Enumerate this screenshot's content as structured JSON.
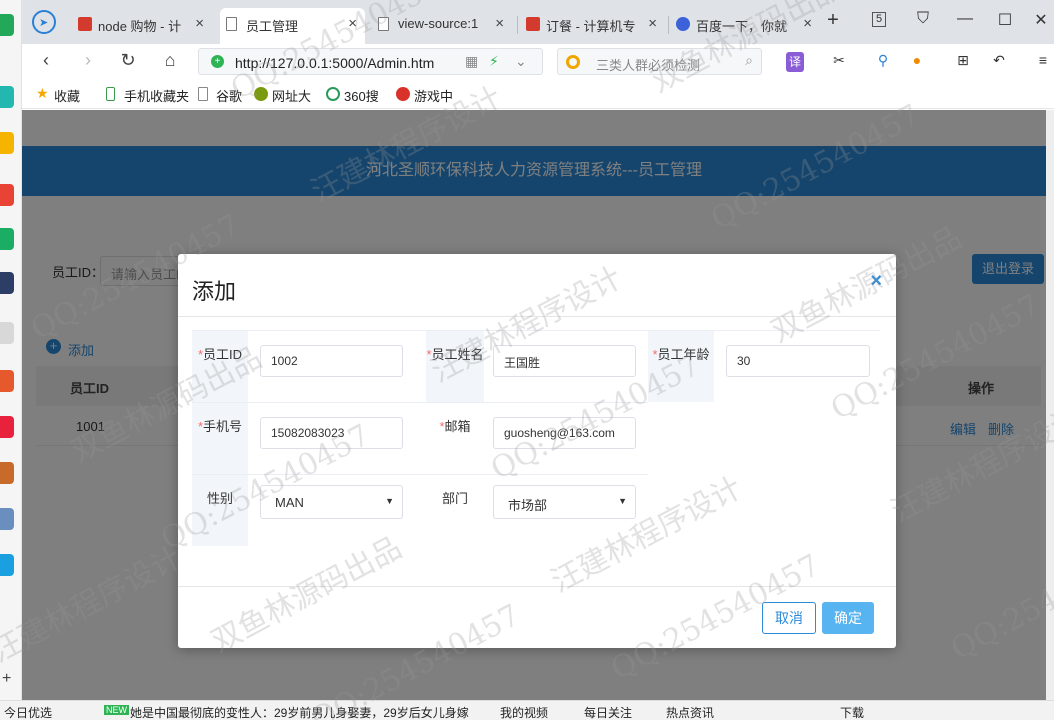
{
  "browser": {
    "tabs": [
      {
        "title": "node 购物 - 计",
        "close": "×"
      },
      {
        "title": "员工管理",
        "close": "×"
      },
      {
        "title": "view-source:1",
        "close": "×"
      },
      {
        "title": "订餐 - 计算机专",
        "close": "×"
      },
      {
        "title": "百度一下，你就",
        "close": "×"
      }
    ],
    "new_tab": "+",
    "badge": "5",
    "url": "http://127.0.0.1:5000/Admin.htm",
    "search_placeholder": "三类人群必须检测",
    "translate": "译",
    "bookmarks": [
      "收藏",
      "手机收藏夹",
      "谷歌",
      "网址大",
      "360搜",
      "游戏中"
    ]
  },
  "page": {
    "banner_title": "河北圣顺环保科技人力资源管理系统---员工管理",
    "search_label": "员工ID：",
    "search_placeholder": "请输入员工ID",
    "logout_label": "退出登录",
    "add_label": "添加",
    "table": {
      "headers": [
        "员工ID",
        "操作"
      ],
      "rows": [
        {
          "id": "1001",
          "edit": "编辑",
          "delete": "删除"
        }
      ]
    }
  },
  "modal": {
    "title": "添加",
    "close": "×",
    "required_mark": "*",
    "fields": {
      "id": {
        "label": "员工ID",
        "value": "1002"
      },
      "name": {
        "label": "员工姓名",
        "value": "王国胜"
      },
      "age": {
        "label": "员工年龄",
        "value": "30"
      },
      "phone": {
        "label": "手机号",
        "value": "15082083023"
      },
      "email": {
        "label": "邮箱",
        "value": "guosheng@163.com"
      },
      "gender": {
        "label": "性别",
        "value": "MAN"
      },
      "dept": {
        "label": "部门",
        "value": "市场部"
      }
    },
    "cancel_label": "取消",
    "confirm_label": "确定"
  },
  "watermarks": [
    "QQ:254540457",
    "双鱼林源码出品",
    "汪建林程序设计"
  ],
  "statusbar": {
    "items": [
      "今日优选",
      "她是中国最彻底的变性人：29岁前男儿身娶妻，29岁后女儿身嫁",
      "我的视频",
      "每日关注",
      "热点资讯",
      "下载"
    ]
  }
}
